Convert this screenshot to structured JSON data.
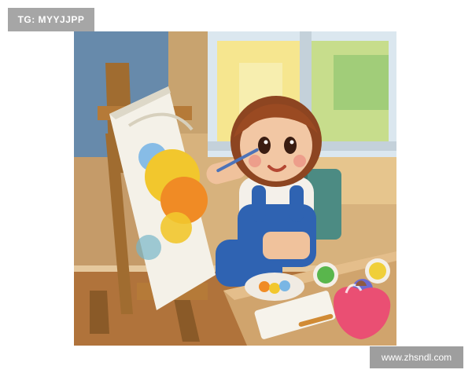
{
  "overlay_tag": {
    "text": "TG: MYYJJPP"
  },
  "watermark": {
    "text": "www.zhsndl.com"
  },
  "scene": {
    "subject": "child-painting-at-easel",
    "palette": {
      "wall": "#d9b27a",
      "window_light": "#f4e79a",
      "hair": "#9a4a22",
      "overalls": "#2f63b2",
      "shirt": "#f3f0ea",
      "easel": "#9b6a2f",
      "canvas": "#f2f0e8",
      "paint_yellow": "#f2c72d",
      "paint_orange": "#f08b25",
      "paint_blue": "#79b6e4",
      "table": "#c89a59",
      "chair": "#3f7f7a"
    }
  }
}
